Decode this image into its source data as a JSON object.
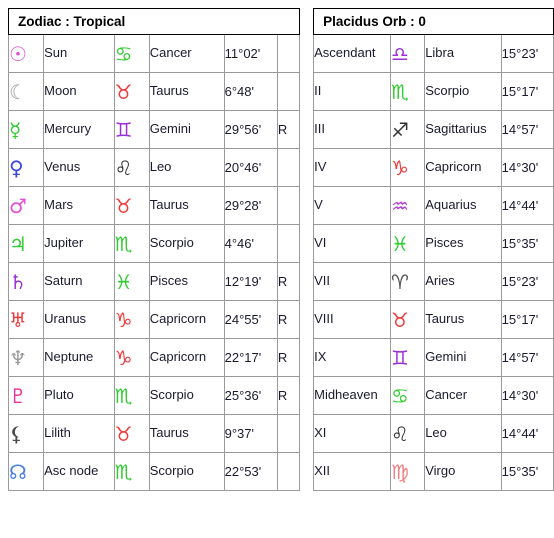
{
  "left_table": {
    "header": "Zodiac : Tropical",
    "rows": [
      {
        "planet_glyph": "☉",
        "planet_color": "#e24fd4",
        "planet": "Sun",
        "sign_glyph": "♋",
        "sign_color": "#2ecc2e",
        "sign": "Cancer",
        "degree": "11°02'",
        "retrograde": ""
      },
      {
        "planet_glyph": "☾",
        "planet_color": "#9a9a9a",
        "planet": "Moon",
        "sign_glyph": "♉",
        "sign_color": "#ef3a3a",
        "sign": "Taurus",
        "degree": "6°48'",
        "retrograde": ""
      },
      {
        "planet_glyph": "☿",
        "planet_color": "#2ecc2e",
        "planet": "Mercury",
        "sign_glyph": "♊",
        "sign_color": "#9b30d9",
        "sign": "Gemini",
        "degree": "29°56'",
        "retrograde": "R"
      },
      {
        "planet_glyph": "♀",
        "planet_color": "#3a46e0",
        "planet": "Venus",
        "sign_glyph": "♌",
        "sign_color": "#333333",
        "sign": "Leo",
        "degree": "20°46'",
        "retrograde": ""
      },
      {
        "planet_glyph": "♂",
        "planet_color": "#e24fd4",
        "planet": "Mars",
        "sign_glyph": "♉",
        "sign_color": "#ef3a3a",
        "sign": "Taurus",
        "degree": "29°28'",
        "retrograde": ""
      },
      {
        "planet_glyph": "♃",
        "planet_color": "#2ecc2e",
        "planet": "Jupiter",
        "sign_glyph": "♏",
        "sign_color": "#2ecc2e",
        "sign": "Scorpio",
        "degree": "4°46'",
        "retrograde": ""
      },
      {
        "planet_glyph": "♄",
        "planet_color": "#9b30d9",
        "planet": "Saturn",
        "sign_glyph": "♓",
        "sign_color": "#2ecc2e",
        "sign": "Pisces",
        "degree": "12°19'",
        "retrograde": "R"
      },
      {
        "planet_glyph": "♅",
        "planet_color": "#ef3a3a",
        "planet": "Uranus",
        "sign_glyph": "♑",
        "sign_color": "#ef3a3a",
        "sign": "Capricorn",
        "degree": "24°55'",
        "retrograde": "R"
      },
      {
        "planet_glyph": "♆",
        "planet_color": "#9a9a9a",
        "planet": "Neptune",
        "sign_glyph": "♑",
        "sign_color": "#ef3a3a",
        "sign": "Capricorn",
        "degree": "22°17'",
        "retrograde": "R"
      },
      {
        "planet_glyph": "♇",
        "planet_color": "#f0309a",
        "planet": "Pluto",
        "sign_glyph": "♏",
        "sign_color": "#2ecc2e",
        "sign": "Scorpio",
        "degree": "25°36'",
        "retrograde": "R"
      },
      {
        "planet_glyph": "⚸",
        "planet_color": "#4a4a4a",
        "planet": "Lilith",
        "sign_glyph": "♉",
        "sign_color": "#ef3a3a",
        "sign": "Taurus",
        "degree": "9°37'",
        "retrograde": ""
      },
      {
        "planet_glyph": "☊",
        "planet_color": "#4a7fe0",
        "planet": "Asc node",
        "sign_glyph": "♏",
        "sign_color": "#2ecc2e",
        "sign": "Scorpio",
        "degree": "22°53'",
        "retrograde": ""
      }
    ]
  },
  "right_table": {
    "header": "Placidus Orb : 0",
    "rows": [
      {
        "house": "Ascendant",
        "sign_glyph": "♎",
        "sign_color": "#9b30d9",
        "sign": "Libra",
        "degree": "15°23'"
      },
      {
        "house": "II",
        "sign_glyph": "♏",
        "sign_color": "#2ecc2e",
        "sign": "Scorpio",
        "degree": "15°17'"
      },
      {
        "house": "III",
        "sign_glyph": "♐",
        "sign_color": "#333333",
        "sign": "Sagittarius",
        "degree": "14°57'"
      },
      {
        "house": "IV",
        "sign_glyph": "♑",
        "sign_color": "#ef3a3a",
        "sign": "Capricorn",
        "degree": "14°30'"
      },
      {
        "house": "V",
        "sign_glyph": "♒",
        "sign_color": "#b040d0",
        "sign": "Aquarius",
        "degree": "14°44'"
      },
      {
        "house": "VI",
        "sign_glyph": "♓",
        "sign_color": "#2ecc2e",
        "sign": "Pisces",
        "degree": "15°35'"
      },
      {
        "house": "VII",
        "sign_glyph": "♈",
        "sign_color": "#55555a",
        "sign": "Aries",
        "degree": "15°23'"
      },
      {
        "house": "VIII",
        "sign_glyph": "♉",
        "sign_color": "#ef3a3a",
        "sign": "Taurus",
        "degree": "15°17'"
      },
      {
        "house": "IX",
        "sign_glyph": "♊",
        "sign_color": "#9b30d9",
        "sign": "Gemini",
        "degree": "14°57'"
      },
      {
        "house": "Midheaven",
        "sign_glyph": "♋",
        "sign_color": "#2ecc2e",
        "sign": "Cancer",
        "degree": "14°30'"
      },
      {
        "house": "XI",
        "sign_glyph": "♌",
        "sign_color": "#333333",
        "sign": "Leo",
        "degree": "14°44'"
      },
      {
        "house": "XII",
        "sign_glyph": "♍",
        "sign_color": "#f08080",
        "sign": "Virgo",
        "degree": "15°35'"
      }
    ]
  }
}
